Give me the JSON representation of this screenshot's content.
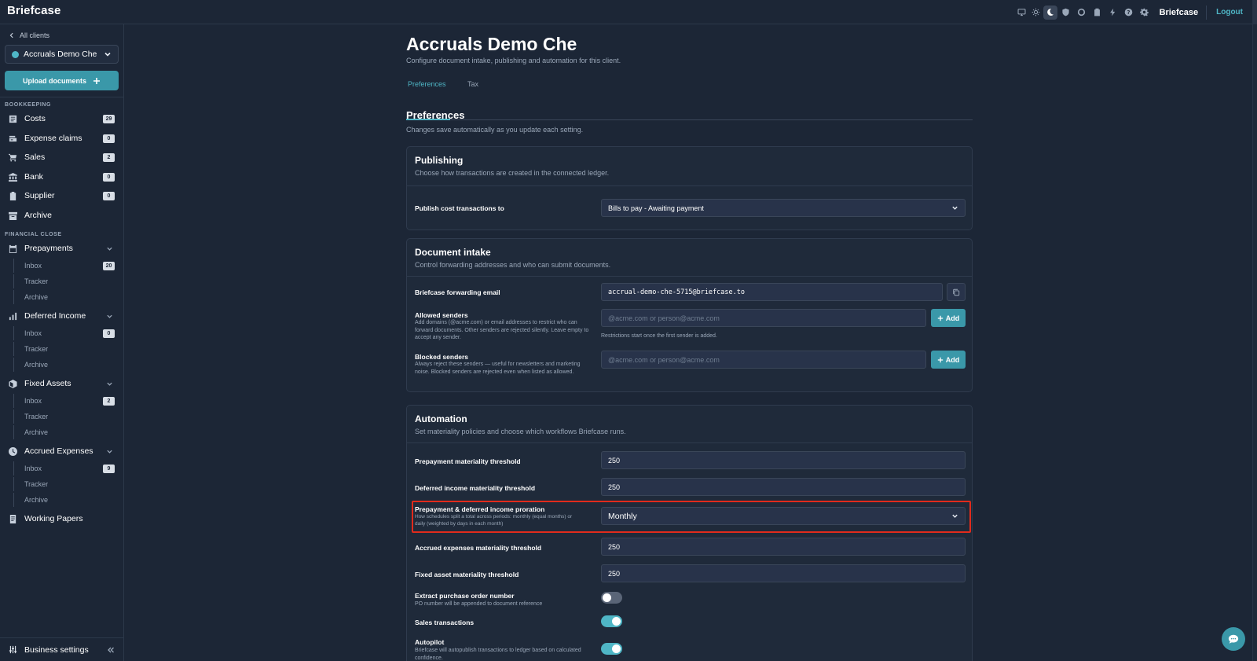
{
  "app": {
    "brand": "Briefcase"
  },
  "topbar": {
    "icons": [
      "monitor-icon",
      "sun-icon",
      "moon-icon",
      "shield-icon",
      "circle-icon",
      "clipboard-icon",
      "bolt-icon",
      "help-icon",
      "gear-icon"
    ],
    "client": "Briefcase",
    "logout": "Logout"
  },
  "sidebar": {
    "back": "All clients",
    "client_select": "Accruals Demo Che",
    "upload": "Upload documents",
    "section_bookkeeping": "BOOKKEEPING",
    "bookkeeping": [
      {
        "label": "Costs",
        "badge": "29",
        "icon": "receipt-icon"
      },
      {
        "label": "Expense claims",
        "badge": "0",
        "icon": "card-icon"
      },
      {
        "label": "Sales",
        "badge": "2",
        "icon": "cart-icon"
      },
      {
        "label": "Bank",
        "badge": "0",
        "icon": "bank-icon"
      },
      {
        "label": "Supplier",
        "badge": "0",
        "icon": "clipboard-icon"
      },
      {
        "label": "Archive",
        "badge": "",
        "icon": "archive-icon"
      }
    ],
    "section_financial_close": "FINANCIAL CLOSE",
    "prepayments": {
      "label": "Prepayments",
      "inbox": "Inbox",
      "inbox_badge": "20",
      "tracker": "Tracker",
      "archive": "Archive"
    },
    "deferred_income": {
      "label": "Deferred Income",
      "inbox": "Inbox",
      "inbox_badge": "0",
      "tracker": "Tracker",
      "archive": "Archive"
    },
    "fixed_assets": {
      "label": "Fixed Assets",
      "inbox": "Inbox",
      "inbox_badge": "2",
      "tracker": "Tracker",
      "archive": "Archive"
    },
    "accrued_expenses": {
      "label": "Accrued Expenses",
      "inbox": "Inbox",
      "inbox_badge": "9",
      "tracker": "Tracker",
      "archive": "Archive"
    },
    "working_papers": "Working Papers",
    "business_settings": "Business settings"
  },
  "main": {
    "title": "Accruals Demo Che",
    "subtitle": "Configure document intake, publishing and automation for this client.",
    "tabs": [
      {
        "label": "Preferences"
      },
      {
        "label": "Tax"
      }
    ],
    "section_title": "Preferences",
    "section_sub": "Changes save automatically as you update each setting.",
    "publishing": {
      "title": "Publishing",
      "sub": "Choose how transactions are created in the connected ledger.",
      "publish_label": "Publish cost transactions to",
      "publish_value": "Bills to pay - Awaiting payment"
    },
    "intake": {
      "title": "Document intake",
      "sub": "Control forwarding addresses and who can submit documents.",
      "forwarding_label": "Briefcase forwarding email",
      "forwarding_value": "accrual-demo-che-5715@briefcase.to",
      "allowed_label": "Allowed senders",
      "allowed_help": "Add domains (@acme.com) or email addresses to restrict who can forward documents. Other senders are rejected silently. Leave empty to accept any sender.",
      "allowed_placeholder": "@acme.com or person@acme.com",
      "allowed_note": "Restrictions start once the first sender is added.",
      "blocked_label": "Blocked senders",
      "blocked_help": "Always reject these senders — useful for newsletters and marketing noise. Blocked senders are rejected even when listed as allowed.",
      "blocked_placeholder": "@acme.com or person@acme.com",
      "add_label": "Add"
    },
    "automation": {
      "title": "Automation",
      "sub": "Set materiality policies and choose which workflows Briefcase runs.",
      "prepayment_threshold_label": "Prepayment materiality threshold",
      "prepayment_threshold_value": "250",
      "deferred_threshold_label": "Deferred income materiality threshold",
      "deferred_threshold_value": "250",
      "proration_label": "Prepayment & deferred income proration",
      "proration_help": "How schedules split a total across periods: monthly (equal months) or daily (weighted by days in each month)",
      "proration_value": "Monthly",
      "accrued_threshold_label": "Accrued expenses materiality threshold",
      "accrued_threshold_value": "250",
      "fixed_threshold_label": "Fixed asset materiality threshold",
      "fixed_threshold_value": "250",
      "po_label": "Extract purchase order number",
      "po_help": "PO number will be appended to document reference",
      "po_enabled": false,
      "sales_label": "Sales transactions",
      "sales_enabled": true,
      "autopilot_label": "Autopilot",
      "autopilot_help": "Briefcase will autopublish transactions to ledger based on calculated confidence.",
      "autopilot_enabled": true
    }
  },
  "colors": {
    "accent": "#4fb6c6",
    "button": "#3a98a9",
    "highlight": "#e12b1c",
    "background": "#1c2636"
  }
}
